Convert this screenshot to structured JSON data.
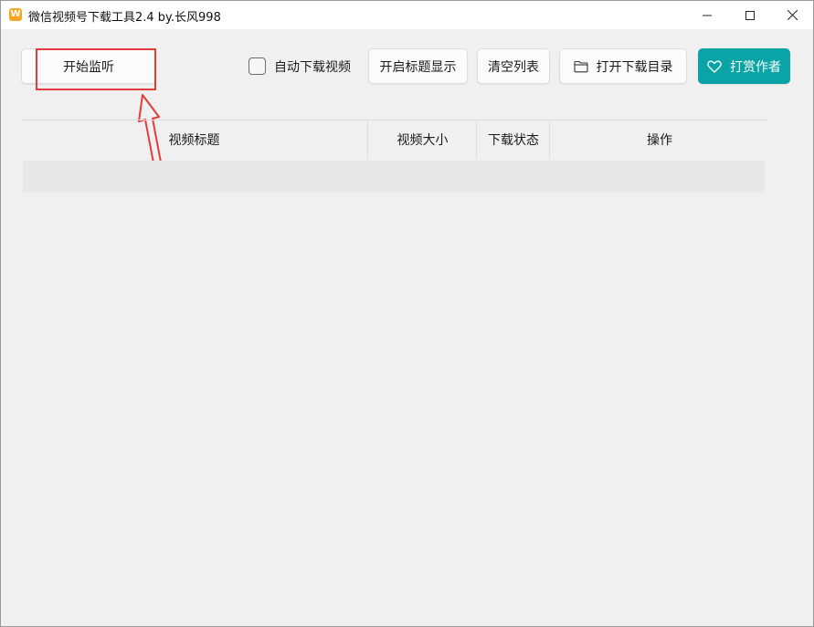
{
  "window": {
    "title": "微信视频号下载工具2.4 by.长风998",
    "app_icon_glyph": "W"
  },
  "toolbar": {
    "start_label": "开始监听",
    "auto_download_label": "自动下载视频",
    "auto_download_checked": false,
    "title_display_label": "开启标题显示",
    "clear_label": "清空列表",
    "open_dir_label": "打开下载目录",
    "donate_label": "打赏作者",
    "open_dir_icon": "folder-icon",
    "donate_icon": "heart-icon"
  },
  "table": {
    "columns": [
      "视频标题",
      "视频大小",
      "下载状态",
      "操作"
    ],
    "rows": []
  },
  "colors": {
    "accent": "#0aa4a7",
    "annotation": "#e23b3b",
    "background": "#f0f0f0"
  }
}
